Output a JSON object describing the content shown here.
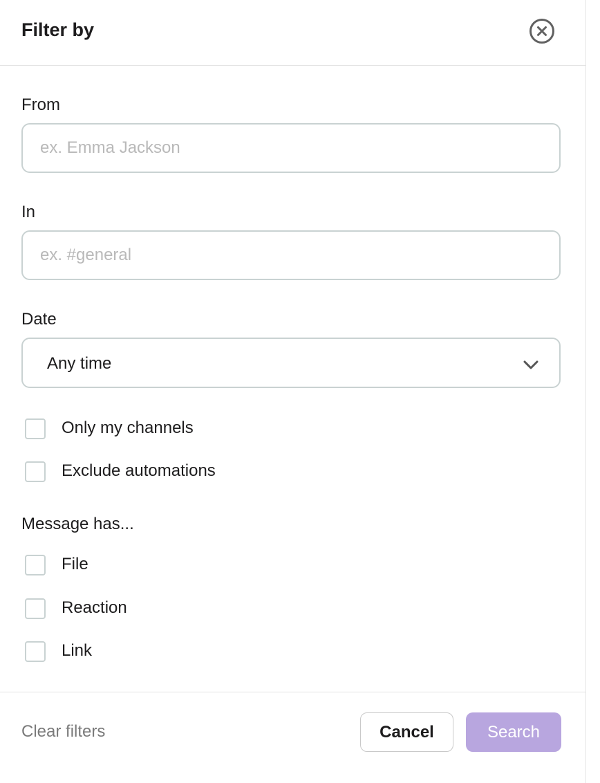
{
  "header": {
    "title": "Filter by",
    "close_icon": "close-circle-icon"
  },
  "from": {
    "label": "From",
    "placeholder": "ex. Emma Jackson",
    "value": ""
  },
  "in": {
    "label": "In",
    "placeholder": "ex. #general",
    "value": ""
  },
  "date": {
    "label": "Date",
    "selected": "Any time",
    "icon": "chevron-down-icon"
  },
  "options": [
    {
      "label": "Only my channels",
      "checked": false
    },
    {
      "label": "Exclude automations",
      "checked": false
    }
  ],
  "message_has": {
    "label": "Message has...",
    "items": [
      {
        "label": "File",
        "checked": false
      },
      {
        "label": "Reaction",
        "checked": false
      },
      {
        "label": "Link",
        "checked": false
      }
    ]
  },
  "footer": {
    "clear_label": "Clear filters",
    "cancel_label": "Cancel",
    "search_label": "Search"
  },
  "colors": {
    "accent_disabled": "#b8a6df",
    "border": "#c9d2d2",
    "text": "#1d1c1d",
    "muted": "#7a7a7a"
  }
}
